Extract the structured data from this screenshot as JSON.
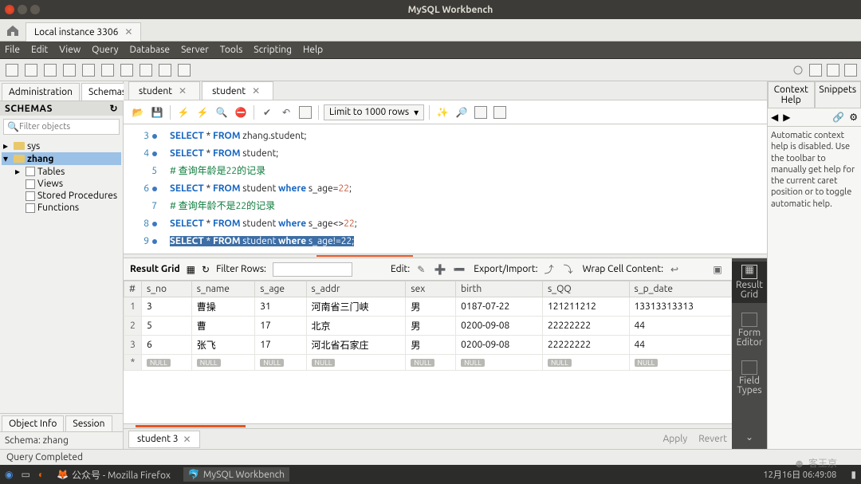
{
  "window": {
    "title": "MySQL Workbench"
  },
  "conn_tab": "Local instance 3306",
  "menu": {
    "file": "File",
    "edit": "Edit",
    "view": "View",
    "query": "Query",
    "database": "Database",
    "server": "Server",
    "tools": "Tools",
    "scripting": "Scripting",
    "help": "Help"
  },
  "sidebar": {
    "tabs": {
      "admin": "Administration",
      "schemas": "Schemas"
    },
    "header": "SCHEMAS",
    "filter_ph": "Filter objects",
    "tree": {
      "sys": "sys",
      "zhang": "zhang",
      "tables": "Tables",
      "views": "Views",
      "stored": "Stored Procedures",
      "functions": "Functions"
    },
    "obj_tabs": {
      "info": "Object Info",
      "session": "Session"
    },
    "schema_line": "Schema: zhang"
  },
  "main_tabs": {
    "t1": "student",
    "t2": "student"
  },
  "editor_toolbar": {
    "limit": "Limit to 1000 rows"
  },
  "code": {
    "l3": {
      "n": "3",
      "kw1": "SELECT",
      "star": "*",
      "kw2": "FROM",
      "rest": "zhang.student;"
    },
    "l4": {
      "n": "4",
      "kw1": "SELECT",
      "star": "*",
      "kw2": "FROM",
      "rest": "student;"
    },
    "l5": {
      "n": "5",
      "cmt": "# 查询年龄是22的记录"
    },
    "l6": {
      "n": "6",
      "kw1": "SELECT",
      "star": "*",
      "kw2": "FROM",
      "tbl": "student",
      "kw3": "where",
      "col": "s_age=",
      "val": "22",
      "semi": ";"
    },
    "l7": {
      "n": "7",
      "cmt": "# 查询年龄不是22的记录"
    },
    "l8": {
      "n": "8",
      "kw1": "SELECT",
      "star": "*",
      "kw2": "FROM",
      "tbl": "student",
      "kw3": "where",
      "col": "s_age<>",
      "val": "22",
      "semi": ";"
    },
    "l9": {
      "n": "9",
      "kw1": "SELECT",
      "star": "*",
      "kw2": "FROM",
      "tbl": "student",
      "kw3": "where",
      "col": "s_age!=",
      "val": "22",
      "semi": ";"
    }
  },
  "grid": {
    "toolbar": {
      "label": "Result Grid",
      "filter": "Filter Rows:",
      "edit": "Edit:",
      "export": "Export/Import:",
      "wrap": "Wrap Cell Content:"
    },
    "columns": [
      "#",
      "s_no",
      "s_name",
      "s_age",
      "s_addr",
      "sex",
      "birth",
      "s_QQ",
      "s_p_date"
    ],
    "rows": [
      {
        "rn": "1",
        "c": [
          "3",
          "曹操",
          "31",
          "河南省三门峡",
          "男",
          "0187-07-22",
          "121211212",
          "13313313313"
        ]
      },
      {
        "rn": "2",
        "c": [
          "5",
          "曹",
          "17",
          "北京",
          "男",
          "0200-09-08",
          "22222222",
          "44"
        ]
      },
      {
        "rn": "3",
        "c": [
          "6",
          "张飞",
          "17",
          "河北省石家庄",
          "男",
          "0200-09-08",
          "22222222",
          "44"
        ]
      }
    ],
    "null": "NULL",
    "side": {
      "grid": "Result Grid",
      "form": "Form Editor",
      "types": "Field Types"
    }
  },
  "bottom_tab": "student 3",
  "apply": "Apply",
  "revert": "Revert",
  "right": {
    "tabs": {
      "ctx": "Context Help",
      "snip": "Snippets"
    },
    "body": "Automatic context help is disabled. Use the toolbar to manually get help for the current caret position or to toggle automatic help."
  },
  "status": "Query Completed",
  "taskbar": {
    "firefox": "公众号 - Mozilla Firefox",
    "wb": "MySQL Workbench",
    "time": "12月16日 06:49:08"
  },
  "watermark": "客王京"
}
